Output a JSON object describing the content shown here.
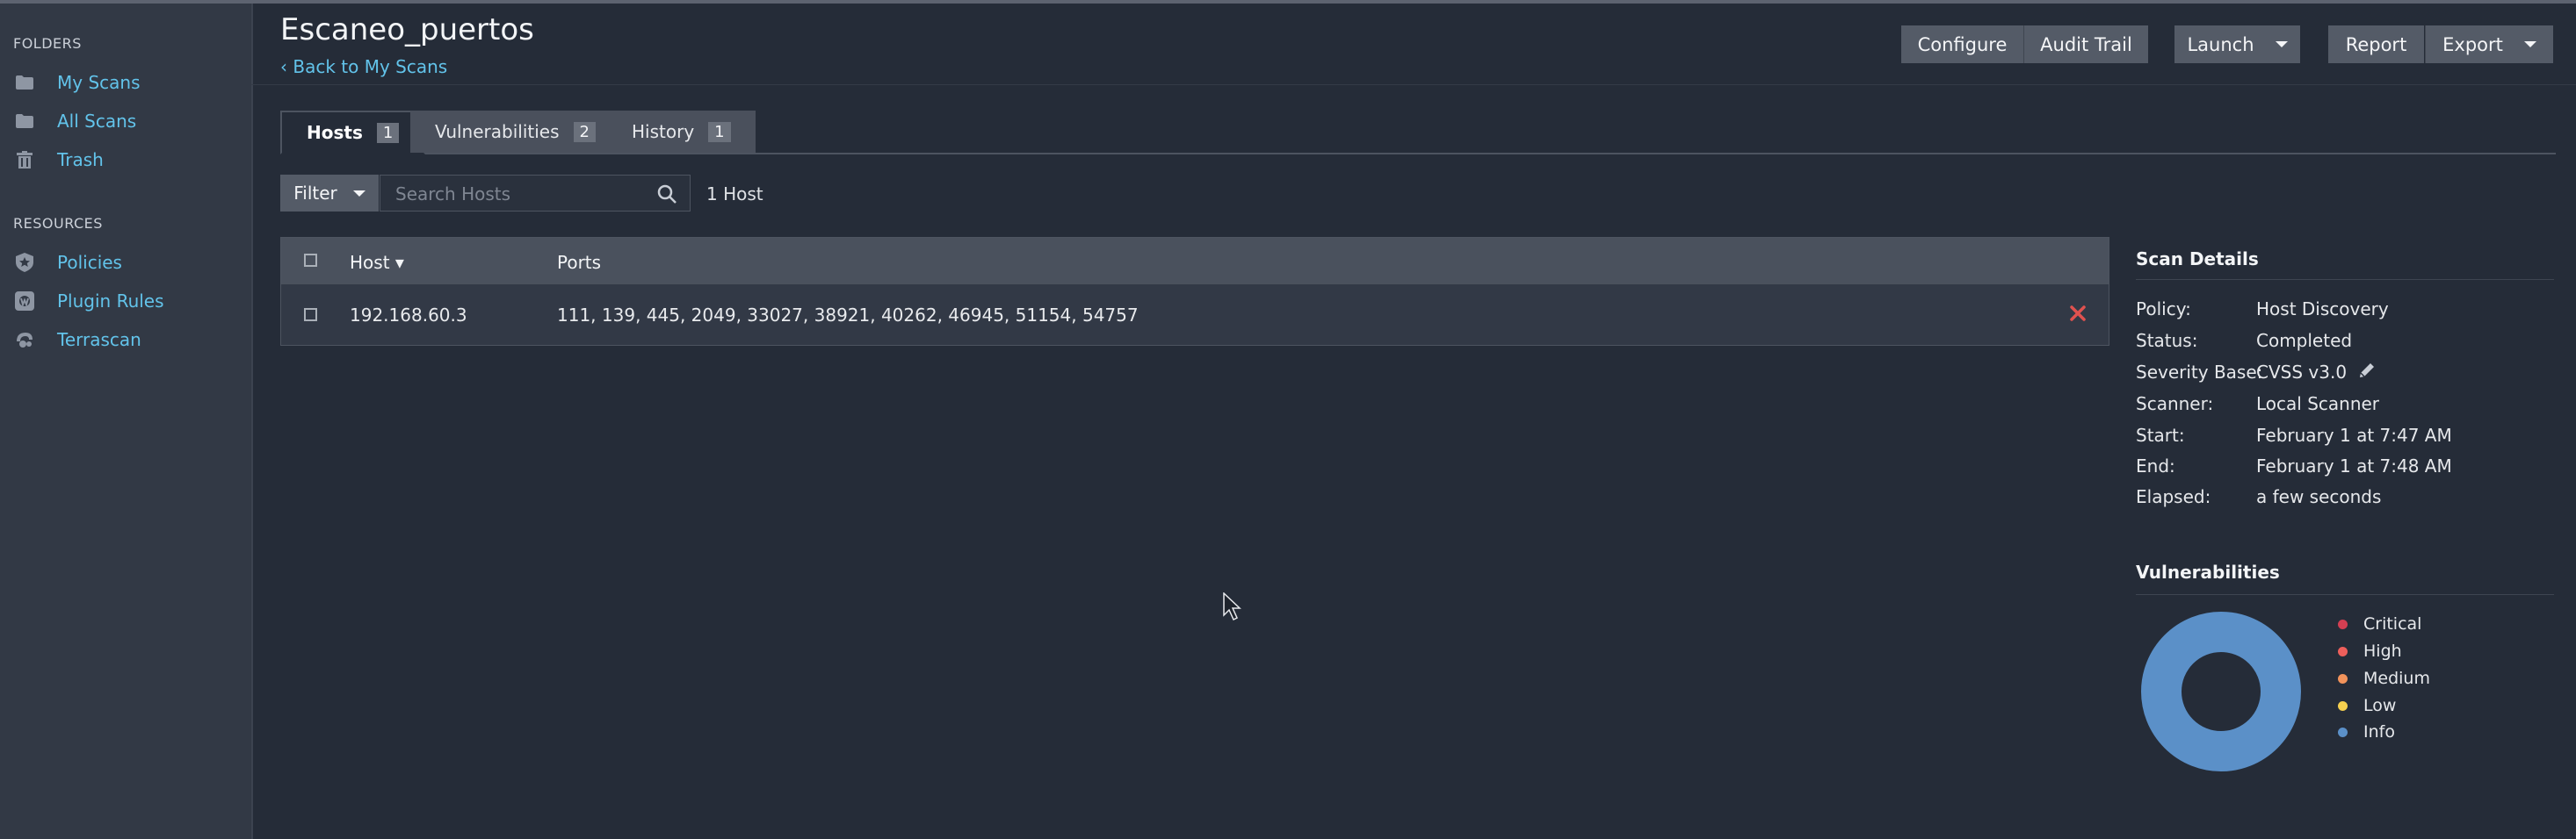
{
  "sidebar": {
    "folders_heading": "FOLDERS",
    "folders": [
      {
        "label": "My Scans",
        "icon": "folder-icon"
      },
      {
        "label": "All Scans",
        "icon": "folder-icon"
      },
      {
        "label": "Trash",
        "icon": "trash-icon"
      }
    ],
    "resources_heading": "RESOURCES",
    "resources": [
      {
        "label": "Policies",
        "icon": "policy-shield-icon"
      },
      {
        "label": "Plugin Rules",
        "icon": "plugin-rules-icon"
      },
      {
        "label": "Terrascan",
        "icon": "terrascan-icon"
      }
    ]
  },
  "header": {
    "title": "Escaneo_puertos",
    "back_link": "Back to My Scans",
    "buttons": {
      "configure": "Configure",
      "audit_trail": "Audit Trail",
      "launch": "Launch",
      "report": "Report",
      "export": "Export"
    }
  },
  "tabs": [
    {
      "label": "Hosts",
      "count": "1",
      "active": true
    },
    {
      "label": "Vulnerabilities",
      "count": "2",
      "active": false
    },
    {
      "label": "History",
      "count": "1",
      "active": false
    }
  ],
  "toolbar": {
    "filter_label": "Filter",
    "search_placeholder": "Search Hosts",
    "host_count": "1 Host"
  },
  "table": {
    "columns": [
      "Host ▾",
      "Ports"
    ],
    "rows": [
      {
        "host": "192.168.60.3",
        "ports": "111, 139, 445, 2049, 33027, 38921, 40262, 46945, 51154, 54757"
      }
    ]
  },
  "scan_details": {
    "title": "Scan Details",
    "fields": [
      {
        "label": "Policy:",
        "value": "Host Discovery"
      },
      {
        "label": "Status:",
        "value": "Completed"
      },
      {
        "label": "Severity Base:",
        "value": "CVSS v3.0"
      },
      {
        "label": "Scanner:",
        "value": "Local Scanner"
      },
      {
        "label": "Start:",
        "value": "February 1 at 7:47 AM"
      },
      {
        "label": "End:",
        "value": "February 1 at 7:48 AM"
      },
      {
        "label": "Elapsed:",
        "value": "a few seconds"
      }
    ]
  },
  "vulnerabilities": {
    "title": "Vulnerabilities",
    "legend": [
      {
        "label": "Critical",
        "color": "#d43f52"
      },
      {
        "label": "High",
        "color": "#ee5f5b"
      },
      {
        "label": "Medium",
        "color": "#f2935b"
      },
      {
        "label": "Low",
        "color": "#f6d04f"
      },
      {
        "label": "Info",
        "color": "#5b90c8"
      }
    ],
    "donut_fraction_info": 1.0
  },
  "colors": {
    "accent_link": "#62c3ea",
    "delete": "#e0524f",
    "background": "#252c38"
  }
}
